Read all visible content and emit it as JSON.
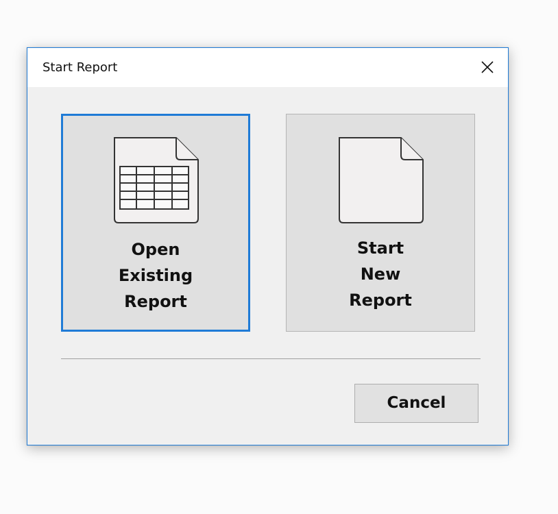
{
  "dialog": {
    "title": "Start Report",
    "close_icon": "close-icon",
    "accent_color": "#1f7bd6"
  },
  "choices": [
    {
      "id": "open-existing-report",
      "icon": "spreadsheet-document-icon",
      "label_lines": [
        "Open",
        "Existing",
        "Report"
      ],
      "selected": true
    },
    {
      "id": "start-new-report",
      "icon": "blank-document-icon",
      "label_lines": [
        "Start",
        "New",
        "Report"
      ],
      "selected": false
    }
  ],
  "footer": {
    "cancel_label": "Cancel"
  }
}
